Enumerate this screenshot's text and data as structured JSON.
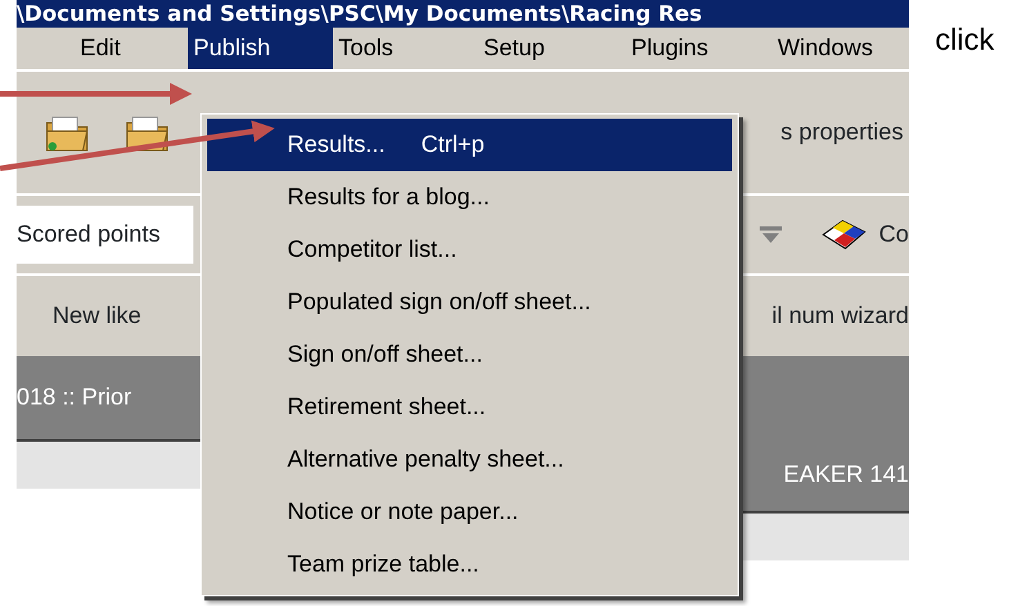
{
  "window": {
    "title": "\\Documents and Settings\\PSC\\My Documents\\Racing Res"
  },
  "note": "click",
  "menu_bar": [
    {
      "label": "Edit",
      "selected": false
    },
    {
      "label": "Publish",
      "selected": true
    },
    {
      "label": "Tools",
      "selected": false
    },
    {
      "label": "Setup",
      "selected": false
    },
    {
      "label": "Plugins",
      "selected": false
    },
    {
      "label": "Windows",
      "selected": false
    }
  ],
  "toolbar": {
    "right_label": "s properties"
  },
  "combo": {
    "value": "Scored points",
    "right_label": "Co"
  },
  "button_row": {
    "left_label": "New like",
    "right_label": "il num wizard"
  },
  "series_bar": {
    "left_label": "018 :: Prior",
    "right_label": "EAKER 141"
  },
  "publish_menu": [
    {
      "label": "Results...",
      "shortcut": "Ctrl+p",
      "selected": true
    },
    {
      "label": "Results for a blog...",
      "selected": false
    },
    {
      "label": "Competitor list...",
      "selected": false
    },
    {
      "label": "Populated sign on/off sheet...",
      "selected": false
    },
    {
      "label": "Sign on/off sheet...",
      "selected": false
    },
    {
      "label": "Retirement sheet...",
      "selected": false
    },
    {
      "label": "Alternative penalty sheet...",
      "selected": false
    },
    {
      "label": "Notice or note paper...",
      "selected": false
    },
    {
      "label": "Team prize table...",
      "selected": false
    }
  ]
}
